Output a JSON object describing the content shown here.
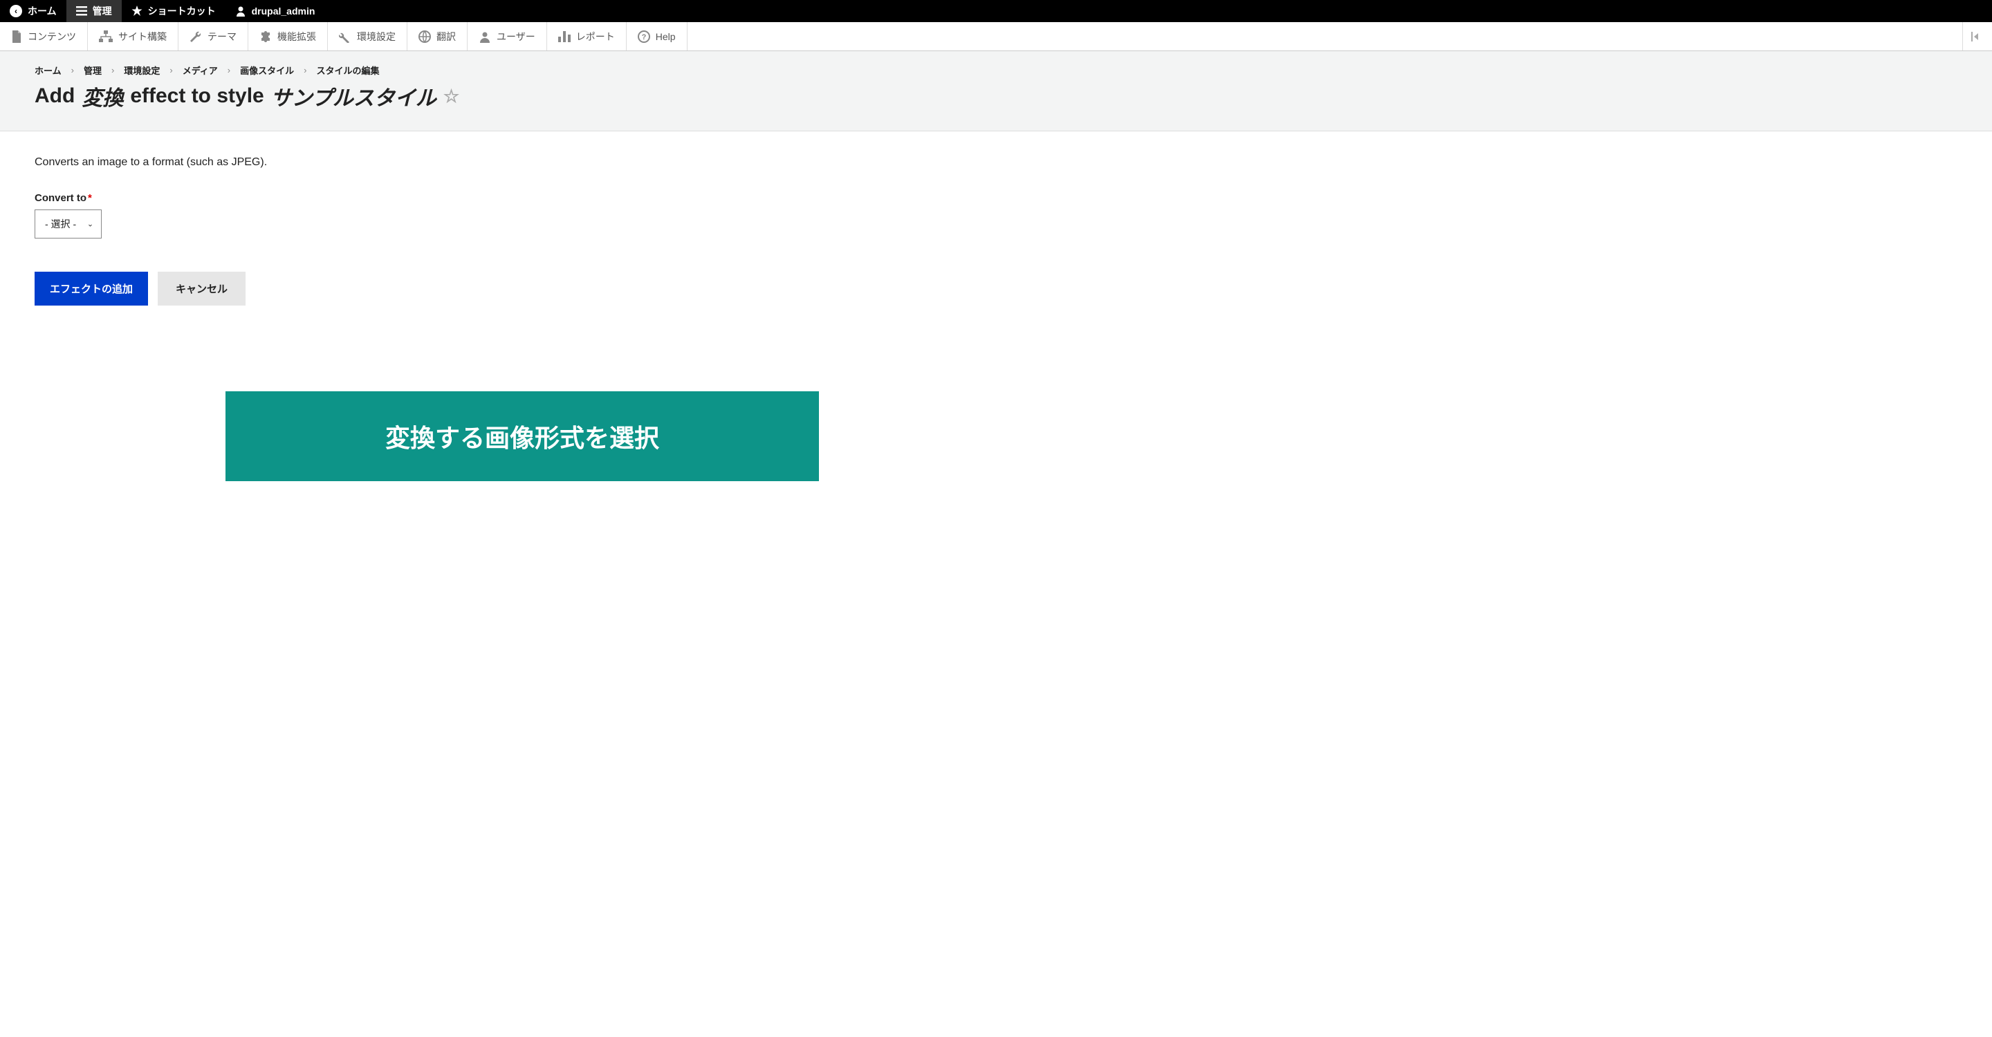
{
  "topbar": {
    "home": "ホーム",
    "manage": "管理",
    "shortcuts": "ショートカット",
    "user": "drupal_admin"
  },
  "admin_toolbar": {
    "content": "コンテンツ",
    "structure": "サイト構築",
    "appearance": "テーマ",
    "extend": "機能拡張",
    "config": "環境設定",
    "translate": "翻訳",
    "people": "ユーザー",
    "reports": "レポート",
    "help": "Help"
  },
  "breadcrumb": {
    "home": "ホーム",
    "admin": "管理",
    "config": "環境設定",
    "media": "メディア",
    "image_styles": "画像スタイル",
    "edit_style": "スタイルの編集"
  },
  "page_title": {
    "prefix": "Add",
    "effect": "変換",
    "mid": "effect to style",
    "style_name": "サンプルスタイル"
  },
  "form": {
    "description": "Converts an image to a format (such as JPEG).",
    "convert_label": "Convert to",
    "select_placeholder": "- 選択 -",
    "submit": "エフェクトの追加",
    "cancel": "キャンセル"
  },
  "overlay": {
    "text": "変換する画像形式を選択"
  }
}
